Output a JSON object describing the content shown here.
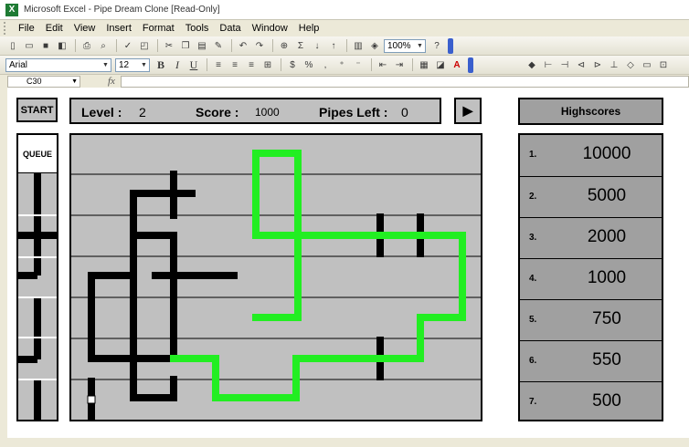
{
  "window": {
    "title": "Microsoft Excel - Pipe Dream Clone  [Read-Only]"
  },
  "menu": [
    {
      "label": "File",
      "name": "menu-file"
    },
    {
      "label": "Edit",
      "name": "menu-edit"
    },
    {
      "label": "View",
      "name": "menu-view"
    },
    {
      "label": "Insert",
      "name": "menu-insert"
    },
    {
      "label": "Format",
      "name": "menu-format"
    },
    {
      "label": "Tools",
      "name": "menu-tools"
    },
    {
      "label": "Data",
      "name": "menu-data"
    },
    {
      "label": "Window",
      "name": "menu-window"
    },
    {
      "label": "Help",
      "name": "menu-help"
    }
  ],
  "toolbar": {
    "zoom": "100%",
    "font_name": "Arial",
    "font_size": "12"
  },
  "formula_bar": {
    "name_box": "C30",
    "fx": "fx",
    "formula": ""
  },
  "game": {
    "start_label": "START",
    "play_label": "▶",
    "level_label": "Level :",
    "level_value": "2",
    "score_label": "Score :",
    "score_value": "1000",
    "pipes_left_label": "Pipes Left :",
    "pipes_left_value": "0",
    "queue_label": "QUEUE",
    "highscores_title": "Highscores"
  },
  "highscores": [
    {
      "rank": "1.",
      "score": "10000"
    },
    {
      "rank": "2.",
      "score": "5000"
    },
    {
      "rank": "3.",
      "score": "2000"
    },
    {
      "rank": "4.",
      "score": "1000"
    },
    {
      "rank": "5.",
      "score": "750"
    },
    {
      "rank": "6.",
      "score": "550"
    },
    {
      "rank": "7.",
      "score": "500"
    }
  ],
  "colors": {
    "pipe_filled": "#22ee22",
    "pipe_empty": "#000000",
    "board_bg": "#c0c0c0",
    "highscore_bg": "#a0a0a0"
  }
}
